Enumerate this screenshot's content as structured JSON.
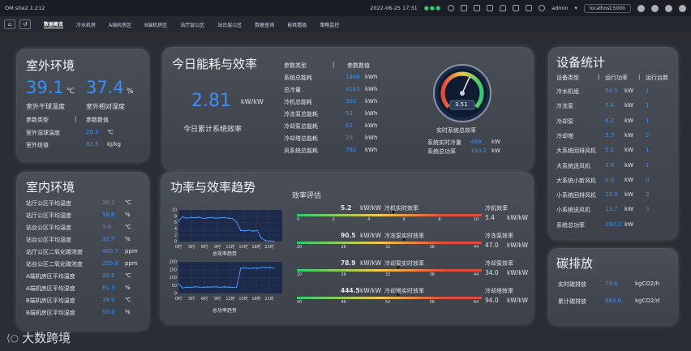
{
  "titlebar": {
    "app_title": "OM site2.1.212",
    "datetime": "2022-06-25 17:31",
    "user": "admin",
    "url": "localhost:5000"
  },
  "nav": {
    "items": [
      "数据概览",
      "冷水机房",
      "A端机房区",
      "B端机房区",
      "站厅层公区",
      "站台层公区",
      "数据查询",
      "能耗看板",
      "策略监控"
    ],
    "active_index": 0
  },
  "outdoor": {
    "title": "室外环境",
    "temp_value": "39.1",
    "temp_unit": "℃",
    "humidity_value": "37.4",
    "humidity_unit": "%",
    "temp_label": "室外干球温度",
    "humidity_label": "室外相对湿度",
    "header_type": "参数类型",
    "header_sep": "|",
    "header_value": "参数数值",
    "rows": [
      {
        "label": "室外湿球温度",
        "value": "26.5",
        "unit": "℃"
      },
      {
        "label": "室外焓值",
        "value": "83.5",
        "unit": "kJ/kg"
      }
    ]
  },
  "energy": {
    "title": "今日能耗与效率",
    "big_value": "2.81",
    "big_unit": "kW/kW",
    "big_label": "今日累计系统效率",
    "header_type": "参数类型",
    "header_sep": "|",
    "header_value": "参数数值",
    "rows": [
      {
        "label": "系统总能耗",
        "value": "1486",
        "unit": "kWh"
      },
      {
        "label": "总冷量",
        "value": "4183",
        "unit": "kWh"
      },
      {
        "label": "冷机总能耗",
        "value": "303",
        "unit": "kWh"
      },
      {
        "label": "冷冻泵总能耗",
        "value": "53",
        "unit": "kWh"
      },
      {
        "label": "冷却泵总能耗",
        "value": "62",
        "unit": "kWh"
      },
      {
        "label": "冷却塔总能耗",
        "value": "29",
        "unit": "kWh"
      },
      {
        "label": "风系统总能耗",
        "value": "782",
        "unit": "kWh"
      }
    ],
    "gauge_value": "3.51",
    "gauge_fraction": 0.59,
    "gauge_label": "实时系统总效率",
    "realtime": [
      {
        "label": "系统实时冷量",
        "value": "469",
        "unit": "kW"
      },
      {
        "label": "系统总功率",
        "value": "190.2",
        "unit": "kW"
      }
    ]
  },
  "stats": {
    "title": "设备统计",
    "headers": [
      "设备类型",
      "|",
      "运行功率",
      "|",
      "运行台数"
    ],
    "rows": [
      {
        "label": "冷水机组",
        "power": "94.5",
        "unit": "kW",
        "count": "1"
      },
      {
        "label": "冷冻泵",
        "power": "5.4",
        "unit": "kW",
        "count": "1"
      },
      {
        "label": "冷却泵",
        "power": "6.2",
        "unit": "kW",
        "count": "1"
      },
      {
        "label": "冷却塔",
        "power": "3.3",
        "unit": "kW",
        "count": "2"
      },
      {
        "label": "大系统回排风机",
        "power": "5.2",
        "unit": "kW",
        "count": "1"
      },
      {
        "label": "大系统送风机",
        "power": "3.9",
        "unit": "kW",
        "count": "1"
      },
      {
        "label": "大系统小新风机",
        "power": "0.0",
        "unit": "kW",
        "count": "0"
      },
      {
        "label": "小系统回排风机",
        "power": "10.0",
        "unit": "kW",
        "count": "3"
      },
      {
        "label": "小系统送风机",
        "power": "13.7",
        "unit": "kW",
        "count": "3"
      },
      {
        "label": "系统总功率",
        "power": "190.2",
        "unit": "kW",
        "count": ""
      }
    ]
  },
  "indoor": {
    "title": "室内环境",
    "rows": [
      {
        "label": "站厅公区平均温度",
        "value": "30.1",
        "unit": "℃"
      },
      {
        "label": "站厅公区平均湿度",
        "value": "58.6",
        "unit": "%"
      },
      {
        "label": "站台公区平均温度",
        "value": "3.6",
        "unit": "℃"
      },
      {
        "label": "站台公区平均湿度",
        "value": "32.7",
        "unit": "%"
      },
      {
        "label": "站厅公区二氧化碳浓度",
        "value": "465.7",
        "unit": "ppm"
      },
      {
        "label": "站台公区二氧化碳浓度",
        "value": "255.8",
        "unit": "ppm"
      },
      {
        "label": "A端机房区平均温度",
        "value": "26.6",
        "unit": "℃"
      },
      {
        "label": "A端机房区平均湿度",
        "value": "61.3",
        "unit": "%"
      },
      {
        "label": "B端机房区平均温度",
        "value": "18.0",
        "unit": "℃"
      },
      {
        "label": "B端机房区平均湿度",
        "value": "50.0",
        "unit": "%"
      }
    ]
  },
  "trend": {
    "title": "功率与效率趋势",
    "eval_title": "效率评估",
    "chart1_label": "总效率趋势",
    "chart2_label": "总功率趋势",
    "xticks": [
      "0时",
      "3时",
      "6时",
      "9时",
      "12时",
      "15时",
      "18时",
      "21时"
    ],
    "evals": [
      {
        "value": "5.2",
        "unit": "kW/kW",
        "name": "冷机实时效率",
        "ticks": [
          "0",
          "2",
          "4",
          "6",
          "8",
          "10"
        ],
        "fraction": 0.52,
        "right_label": "冷机效率",
        "right_value": "5.4",
        "right_unit": "kW/kW"
      },
      {
        "value": "90.5",
        "unit": "kW/kW",
        "name": "冷冻泵实时效率",
        "ticks": [
          "20",
          "26",
          "32",
          "38",
          "44"
        ],
        "fraction": 0.58,
        "right_label": "冷冻泵效率",
        "right_value": "47.0",
        "right_unit": "kW/kW"
      },
      {
        "value": "78.9",
        "unit": "kW/kW",
        "name": "冷却泵实时效率",
        "ticks": [
          "20",
          "26",
          "32",
          "38",
          "44"
        ],
        "fraction": 0.55,
        "right_label": "冷却泵效率",
        "right_value": "34.0",
        "right_unit": "kW/kW"
      },
      {
        "value": "444.5",
        "unit": "kW/kW",
        "name": "冷却塔实时效率",
        "ticks": [
          "40",
          "46",
          "52",
          "58",
          "64"
        ],
        "fraction": 0.55,
        "right_label": "冷却塔效率",
        "right_value": "94.0",
        "right_unit": "kW/kW"
      }
    ]
  },
  "carbon": {
    "title": "碳排放",
    "rows": [
      {
        "label": "实时碳排放",
        "value": "79.6",
        "unit": "kgCO2/h"
      },
      {
        "label": "累计碳排放",
        "value": "863.6",
        "unit": "kgCO2/d"
      }
    ]
  },
  "footer": {
    "logo_text": "大数跨境"
  },
  "chart_data": [
    {
      "type": "line",
      "title": "总效率趋势",
      "x": [
        "0时",
        "3时",
        "6时",
        "9时",
        "12时",
        "15时",
        "18时",
        "21时"
      ],
      "ylim": [
        0,
        10
      ],
      "yticks": [
        0,
        2,
        4,
        6,
        8,
        10
      ],
      "series": [
        {
          "values": [
            6.5,
            7.8,
            7.4,
            7.6,
            7.5,
            7.7,
            7.3,
            7.5,
            7.6,
            7.4,
            7.5,
            7.6,
            7.4,
            7.3,
            6.2,
            3.5,
            3.4,
            3.6,
            3.3,
            3.5,
            1.0,
            0.3,
            0.2,
            0.1
          ]
        }
      ],
      "grid": true
    },
    {
      "type": "line",
      "title": "总功率趋势",
      "x": [
        "0时",
        "3时",
        "6时",
        "9时",
        "12时",
        "15时",
        "18时",
        "21时"
      ],
      "ylim": [
        0,
        200
      ],
      "yticks": [
        0,
        50,
        100,
        150,
        200
      ],
      "series": [
        {
          "values": [
            60,
            35,
            40,
            38,
            42,
            40,
            39,
            41,
            40,
            42,
            39,
            41,
            40,
            38,
            40,
            160,
            162,
            158,
            161,
            159,
            165,
            163,
            164,
            162
          ]
        }
      ],
      "grid": true
    }
  ]
}
